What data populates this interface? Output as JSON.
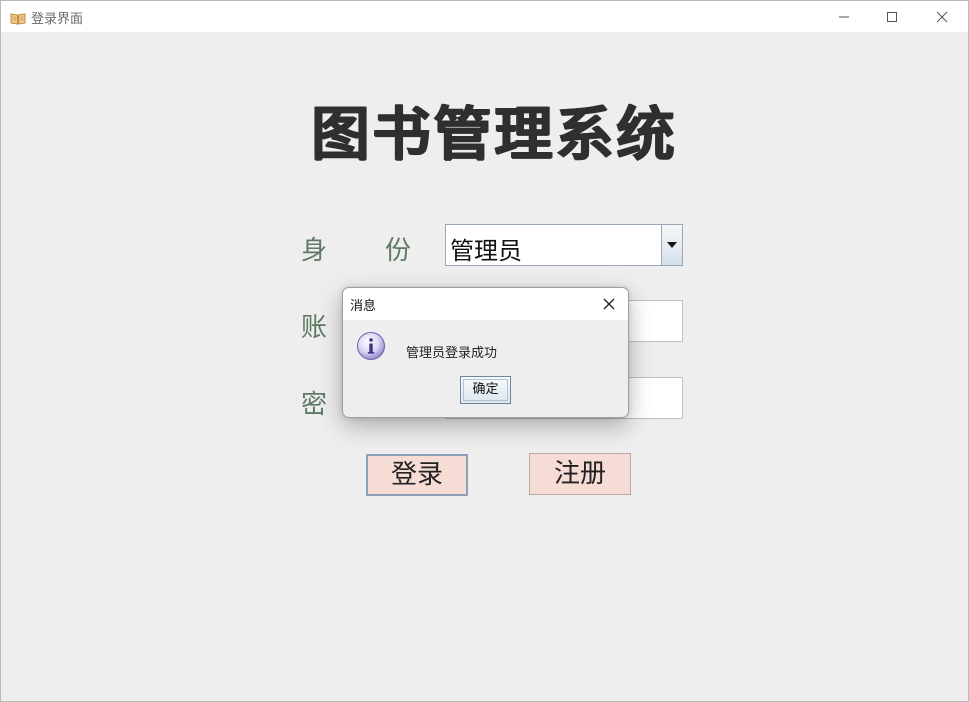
{
  "window": {
    "title": "登录界面",
    "app_icon": "book-icon",
    "controls": [
      "minimize-icon",
      "maximize-icon",
      "close-icon"
    ]
  },
  "main": {
    "app_title": "图书管理系统",
    "identity_label_1": "身",
    "identity_label_2": "份",
    "identity_value": "管理员",
    "account_label": "账",
    "password_label": "密",
    "login_button": "登录",
    "register_button": "注册"
  },
  "dialog": {
    "title": "消息",
    "icon": "info-icon",
    "message": "管理员登录成功",
    "ok_button": "确定"
  },
  "colors": {
    "label_green": "#5f7a62",
    "button_pink": "#f6dcd4",
    "dialog_icon_purple": "#8a7cc4"
  }
}
